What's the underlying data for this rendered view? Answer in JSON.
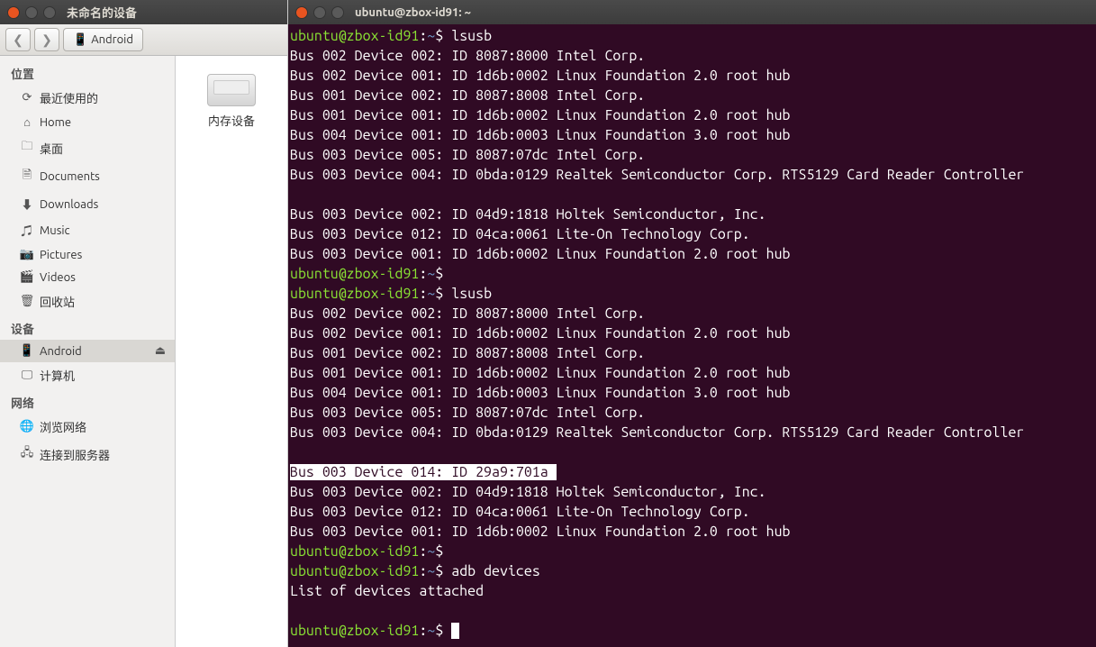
{
  "fm": {
    "title": "未命名的设备",
    "path_label": "Android",
    "sidebar": {
      "places_heading": "位置",
      "places": [
        {
          "icon": "⟳",
          "label": "最近使用的"
        },
        {
          "icon": "⌂",
          "label": "Home"
        },
        {
          "icon": "🗀",
          "label": "桌面"
        },
        {
          "icon": "🗎",
          "label": "Documents"
        },
        {
          "icon": "⬇",
          "label": "Downloads"
        },
        {
          "icon": "♫",
          "label": "Music"
        },
        {
          "icon": "📷",
          "label": "Pictures"
        },
        {
          "icon": "🎬",
          "label": "Videos"
        },
        {
          "icon": "🗑",
          "label": "回收站"
        }
      ],
      "devices_heading": "设备",
      "devices": [
        {
          "icon": "📱",
          "label": "Android",
          "eject": "⏏",
          "active": true
        },
        {
          "icon": "🖵",
          "label": "计算机"
        }
      ],
      "network_heading": "网络",
      "network": [
        {
          "icon": "🌐",
          "label": "浏览网络"
        },
        {
          "icon": "🖧",
          "label": "连接到服务器"
        }
      ]
    },
    "content": {
      "drive_label": "内存设备"
    }
  },
  "term": {
    "title": "ubuntu@zbox-id91: ~",
    "prompt_user": "ubuntu@zbox-id91",
    "prompt_path": "~",
    "prompt_sep": ":",
    "prompt_dollar": "$",
    "lines": [
      {
        "type": "cmd",
        "text": "lsusb"
      },
      {
        "type": "out",
        "text": "Bus 002 Device 002: ID 8087:8000 Intel Corp."
      },
      {
        "type": "out",
        "text": "Bus 002 Device 001: ID 1d6b:0002 Linux Foundation 2.0 root hub"
      },
      {
        "type": "out",
        "text": "Bus 001 Device 002: ID 8087:8008 Intel Corp."
      },
      {
        "type": "out",
        "text": "Bus 001 Device 001: ID 1d6b:0002 Linux Foundation 2.0 root hub"
      },
      {
        "type": "out",
        "text": "Bus 004 Device 001: ID 1d6b:0003 Linux Foundation 3.0 root hub"
      },
      {
        "type": "out",
        "text": "Bus 003 Device 005: ID 8087:07dc Intel Corp."
      },
      {
        "type": "out",
        "text": "Bus 003 Device 004: ID 0bda:0129 Realtek Semiconductor Corp. RTS5129 Card Reader Controller",
        "wrap": true
      },
      {
        "type": "out",
        "text": "Bus 003 Device 002: ID 04d9:1818 Holtek Semiconductor, Inc."
      },
      {
        "type": "out",
        "text": "Bus 003 Device 012: ID 04ca:0061 Lite-On Technology Corp."
      },
      {
        "type": "out",
        "text": "Bus 003 Device 001: ID 1d6b:0002 Linux Foundation 2.0 root hub"
      },
      {
        "type": "cmd",
        "text": ""
      },
      {
        "type": "cmd",
        "text": "lsusb"
      },
      {
        "type": "out",
        "text": "Bus 002 Device 002: ID 8087:8000 Intel Corp."
      },
      {
        "type": "out",
        "text": "Bus 002 Device 001: ID 1d6b:0002 Linux Foundation 2.0 root hub"
      },
      {
        "type": "out",
        "text": "Bus 001 Device 002: ID 8087:8008 Intel Corp."
      },
      {
        "type": "out",
        "text": "Bus 001 Device 001: ID 1d6b:0002 Linux Foundation 2.0 root hub"
      },
      {
        "type": "out",
        "text": "Bus 004 Device 001: ID 1d6b:0003 Linux Foundation 3.0 root hub"
      },
      {
        "type": "out",
        "text": "Bus 003 Device 005: ID 8087:07dc Intel Corp."
      },
      {
        "type": "out",
        "text": "Bus 003 Device 004: ID 0bda:0129 Realtek Semiconductor Corp. RTS5129 Card Reader Controller",
        "wrap": true
      },
      {
        "type": "out",
        "text": "Bus 003 Device 014: ID 29a9:701a ",
        "selected": true,
        "trail": ""
      },
      {
        "type": "out",
        "text": "Bus 003 Device 002: ID 04d9:1818 Holtek Semiconductor, Inc."
      },
      {
        "type": "out",
        "text": "Bus 003 Device 012: ID 04ca:0061 Lite-On Technology Corp."
      },
      {
        "type": "out",
        "text": "Bus 003 Device 001: ID 1d6b:0002 Linux Foundation 2.0 root hub"
      },
      {
        "type": "cmd",
        "text": ""
      },
      {
        "type": "cmd",
        "text": "adb devices"
      },
      {
        "type": "out",
        "text": "List of devices attached"
      },
      {
        "type": "blank"
      },
      {
        "type": "cmd",
        "text": "",
        "cursor": true
      }
    ]
  }
}
